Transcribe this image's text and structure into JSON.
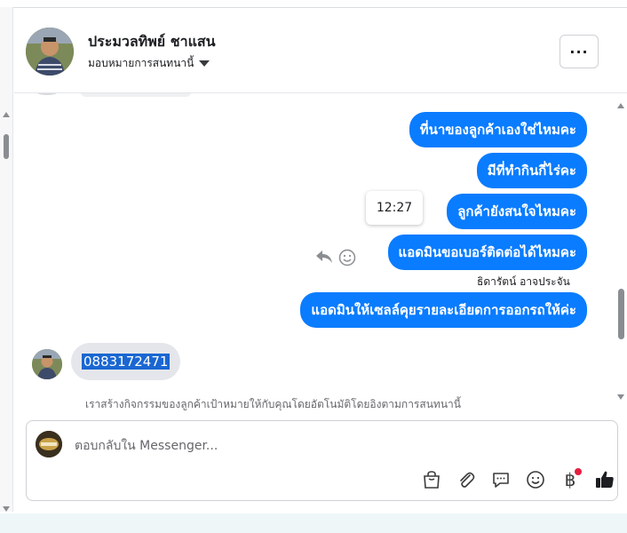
{
  "header": {
    "contact_name": "ประมวลทิพย์ ชาแสน",
    "assign_label": "มอบหมายการสนทนานี้",
    "more_label": "···"
  },
  "messages": {
    "outgoing": [
      "ที่นาของลูกค้าเองใช่ไหมคะ",
      "มีที่ทำกินกี่ไร่คะ",
      "ลูกค้ายังสนใจไหมคะ",
      "แอดมินขอเบอร์ติดต่อได้ไหมคะ",
      "แอดมินให้เซลล์คุยรายละเอียดการออกรถให้ค่ะ"
    ],
    "hover_time": "12:27",
    "sender_name": "ธิดารัตน์ อาจประจัน",
    "incoming_phone": "0883172471",
    "system_note": "เราสร้างกิจกรรมของลูกค้าเป้าหมายให้กับคุณโดยอัตโนมัติโดยอิงตามการสนทนานี้"
  },
  "composer": {
    "placeholder": "ตอบกลับใน Messenger...",
    "baht_symbol": "฿"
  },
  "icons": {
    "more": "more-dots-icon",
    "reply": "reply-arrow-icon",
    "react": "smiley-icon",
    "bag": "shopping-bag-icon",
    "attach": "paperclip-icon",
    "saved_replies": "chat-bubble-icon",
    "emoji": "emoji-icon",
    "payment": "baht-icon",
    "like": "thumbs-up-icon"
  },
  "colors": {
    "accent": "#0a7cff",
    "selection": "#1a67d2",
    "notification_dot": "#e41e3f"
  }
}
